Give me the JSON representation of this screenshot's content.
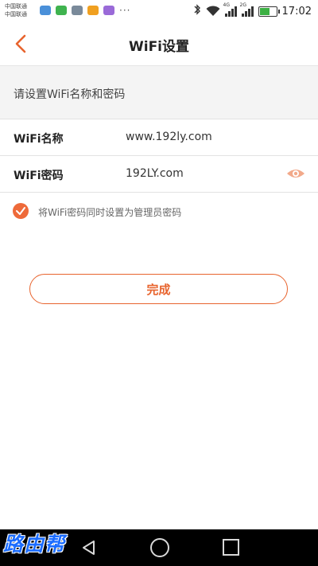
{
  "status_bar": {
    "carrier_line1": "中国联通",
    "carrier_line2": "中国联通",
    "overflow": "···",
    "network_label_1": "4G",
    "network_label_2": "2G",
    "time": "17:02",
    "colors": {
      "battery_fill": "#3cb043"
    }
  },
  "header": {
    "title": "WiFi设置",
    "back_icon": "chevron-left-icon",
    "accent": "#e8642e"
  },
  "section": {
    "hint": "请设置WiFi名称和密码"
  },
  "form": {
    "name_label": "WiFi名称",
    "name_value": "www.192ly.com",
    "password_label": "WiFi密码",
    "password_value": "192LY.com",
    "eye_icon": "eye-icon"
  },
  "option": {
    "checked": true,
    "text": "将WiFi密码同时设置为管理员密码"
  },
  "actions": {
    "done_label": "完成"
  },
  "watermark": {
    "text": "路由帮"
  }
}
